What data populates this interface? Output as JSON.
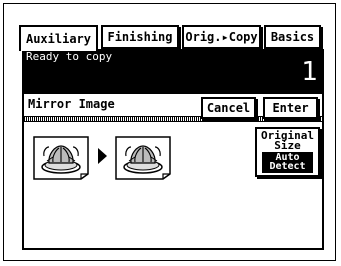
{
  "tabs": [
    {
      "label": "Auxiliary",
      "active": true
    },
    {
      "label": "Finishing",
      "active": false
    },
    {
      "label": "Orig.▸Copy",
      "active": false
    },
    {
      "label": "Basics",
      "active": false
    }
  ],
  "status": {
    "message": "Ready to copy",
    "count": "1"
  },
  "screen": {
    "title": "Mirror Image",
    "cancel_label": "Cancel",
    "enter_label": "Enter",
    "original_size": {
      "label_line1": "Original",
      "label_line2": "Size",
      "value_line1": "Auto",
      "value_line2": "Detect"
    }
  },
  "icons": {
    "original": "original-document-icon",
    "arrow": "arrow-right-icon",
    "mirrored": "mirrored-copy-icon"
  }
}
